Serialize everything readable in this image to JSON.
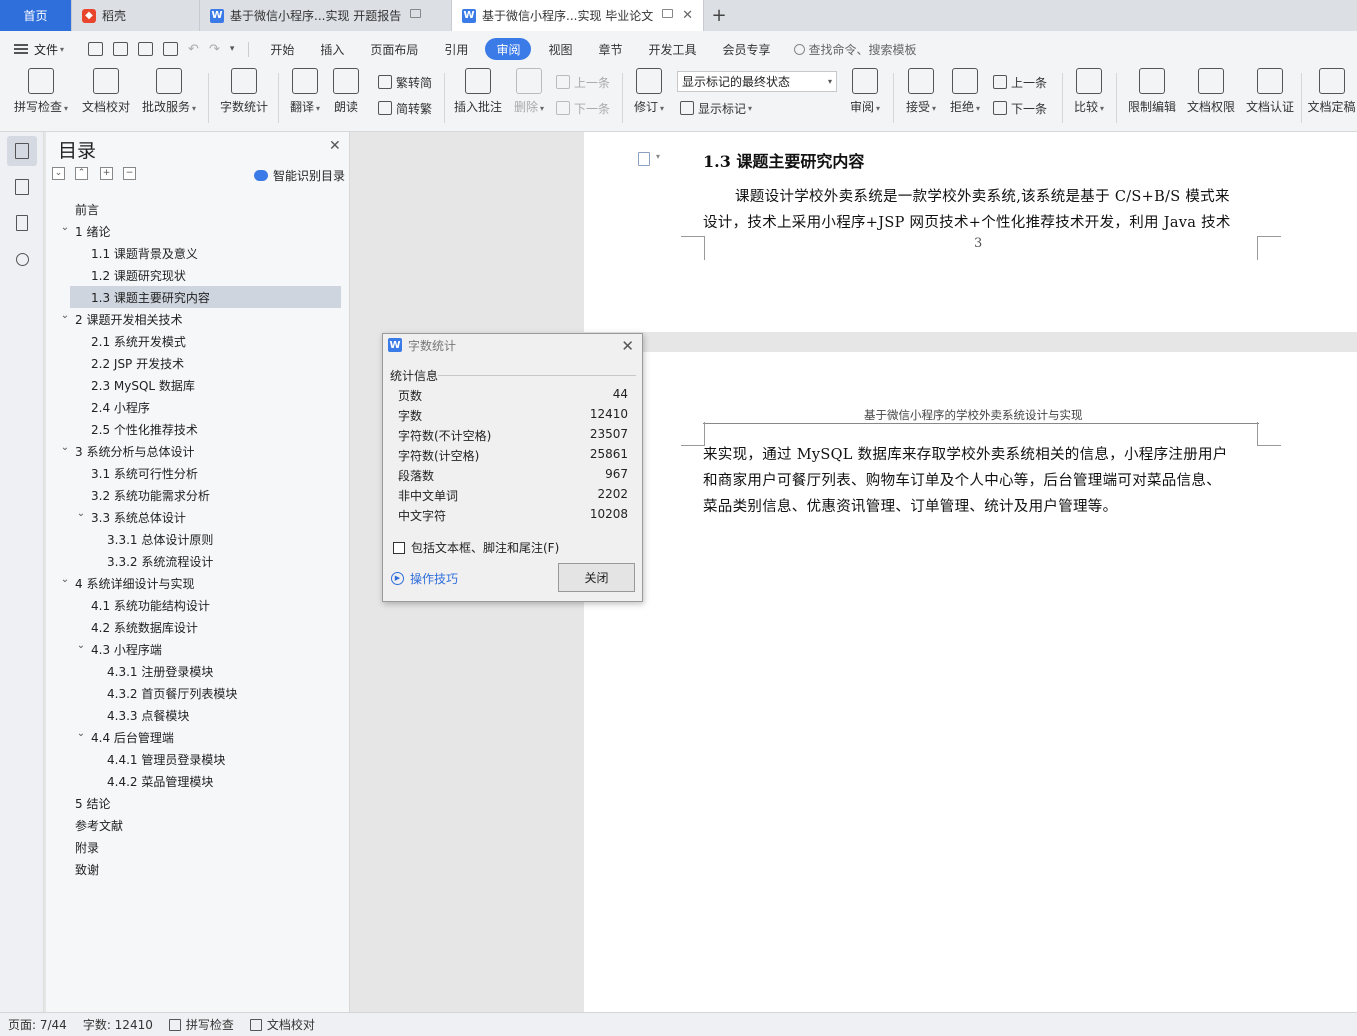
{
  "tabs": {
    "home": "首页",
    "daoke": "稻壳",
    "doc1": "基于微信小程序...实现 开题报告",
    "doc2": "基于微信小程序...实现 毕业论文"
  },
  "menu": {
    "file": "文件",
    "items": [
      "开始",
      "插入",
      "页面布局",
      "引用",
      "审阅",
      "视图",
      "章节",
      "开发工具",
      "会员专享"
    ],
    "search": "查找命令、搜索模板"
  },
  "ribbon": {
    "spellcheck": "拼写检查",
    "doccheck": "文档校对",
    "review_service": "批改服务",
    "word_count": "字数统计",
    "translate": "翻译",
    "read_aloud": "朗读",
    "trad_to_simp": "繁转简",
    "simp_to_trad": "简转繁",
    "insert_comment": "插入批注",
    "delete": "删除",
    "prev_comment": "上一条",
    "next_comment": "下一条",
    "track": "修订",
    "markup_state": "显示标记的最终状态",
    "show_markup": "显示标记",
    "review": "审阅",
    "accept": "接受",
    "reject": "拒绝",
    "prev": "上一条",
    "next": "下一条",
    "compare": "比较",
    "restrict_edit": "限制编辑",
    "doc_rights": "文档权限",
    "doc_auth": "文档认证",
    "doc_final": "文档定稿"
  },
  "toc": {
    "title": "目录",
    "smart": "智能识别目录",
    "items": [
      {
        "label": "前言",
        "level": 0,
        "chev": ""
      },
      {
        "label": "1 绪论",
        "level": 0,
        "chev": "v"
      },
      {
        "label": "1.1 课题背景及意义",
        "level": 1,
        "chev": ""
      },
      {
        "label": "1.2 课题研究现状",
        "level": 1,
        "chev": ""
      },
      {
        "label": "1.3 课题主要研究内容",
        "level": 1,
        "chev": "",
        "selected": true
      },
      {
        "label": "2 课题开发相关技术",
        "level": 0,
        "chev": "v"
      },
      {
        "label": "2.1 系统开发模式",
        "level": 1,
        "chev": ""
      },
      {
        "label": "2.2 JSP 开发技术",
        "level": 1,
        "chev": ""
      },
      {
        "label": "2.3 MySQL 数据库",
        "level": 1,
        "chev": ""
      },
      {
        "label": "2.4  小程序",
        "level": 1,
        "chev": ""
      },
      {
        "label": "2.5  个性化推荐技术",
        "level": 1,
        "chev": ""
      },
      {
        "label": "3 系统分析与总体设计",
        "level": 0,
        "chev": "v"
      },
      {
        "label": "3.1 系统可行性分析",
        "level": 1,
        "chev": ""
      },
      {
        "label": "3.2 系统功能需求分析",
        "level": 1,
        "chev": ""
      },
      {
        "label": "3.3 系统总体设计",
        "level": 1,
        "chev": "v"
      },
      {
        "label": "3.3.1 总体设计原则",
        "level": 2,
        "chev": ""
      },
      {
        "label": "3.3.2 系统流程设计",
        "level": 2,
        "chev": ""
      },
      {
        "label": "4 系统详细设计与实现",
        "level": 0,
        "chev": "v"
      },
      {
        "label": "4.1 系统功能结构设计",
        "level": 1,
        "chev": ""
      },
      {
        "label": "4.2 系统数据库设计",
        "level": 1,
        "chev": ""
      },
      {
        "label": "4.3 小程序端",
        "level": 1,
        "chev": "v"
      },
      {
        "label": "4.3.1 注册登录模块",
        "level": 2,
        "chev": ""
      },
      {
        "label": "4.3.2 首页餐厅列表模块",
        "level": 2,
        "chev": ""
      },
      {
        "label": "4.3.3 点餐模块",
        "level": 2,
        "chev": ""
      },
      {
        "label": "4.4 后台管理端",
        "level": 1,
        "chev": "v"
      },
      {
        "label": "4.4.1 管理员登录模块",
        "level": 2,
        "chev": ""
      },
      {
        "label": "4.4.2 菜品管理模块",
        "level": 2,
        "chev": ""
      },
      {
        "label": "5 结论",
        "level": 0,
        "chev": ""
      },
      {
        "label": "参考文献",
        "level": 0,
        "chev": ""
      },
      {
        "label": "附录",
        "level": 0,
        "chev": ""
      },
      {
        "label": "致谢",
        "level": 0,
        "chev": ""
      }
    ]
  },
  "document": {
    "heading": "1.3 课题主要研究内容",
    "para1_line1": "课题设计学校外卖系统是一款学校外卖系统,该系统是基于 C/S+B/S 模式来",
    "para1_line2": "设计，技术上采用小程序+JSP 网页技术+个性化推荐技术开发，利用 Java 技术",
    "page_number": "3",
    "page_header": "基于微信小程序的学校外卖系统设计与实现",
    "para2_line1": "来实现，通过 MySQL 数据库来存取学校外卖系统相关的信息，小程序注册用户",
    "para2_line2": "和商家用户可餐厅列表、购物车订单及个人中心等，后台管理端可对菜品信息、",
    "para2_line3": "菜品类别信息、优惠资讯管理、订单管理、统计及用户管理等。"
  },
  "dialog": {
    "title": "字数统计",
    "group": "统计信息",
    "stats": [
      {
        "label": "页数",
        "value": "44"
      },
      {
        "label": "字数",
        "value": "12410"
      },
      {
        "label": "字符数(不计空格)",
        "value": "23507"
      },
      {
        "label": "字符数(计空格)",
        "value": "25861"
      },
      {
        "label": "段落数",
        "value": "967"
      },
      {
        "label": "非中文单词",
        "value": "2202"
      },
      {
        "label": "中文字符",
        "value": "10208"
      }
    ],
    "checkbox": "包括文本框、脚注和尾注(F)",
    "tips": "操作技巧",
    "close": "关闭"
  },
  "status": {
    "page": "页面: 7/44",
    "words": "字数: 12410",
    "spell": "拼写检查",
    "proof": "文档校对"
  }
}
